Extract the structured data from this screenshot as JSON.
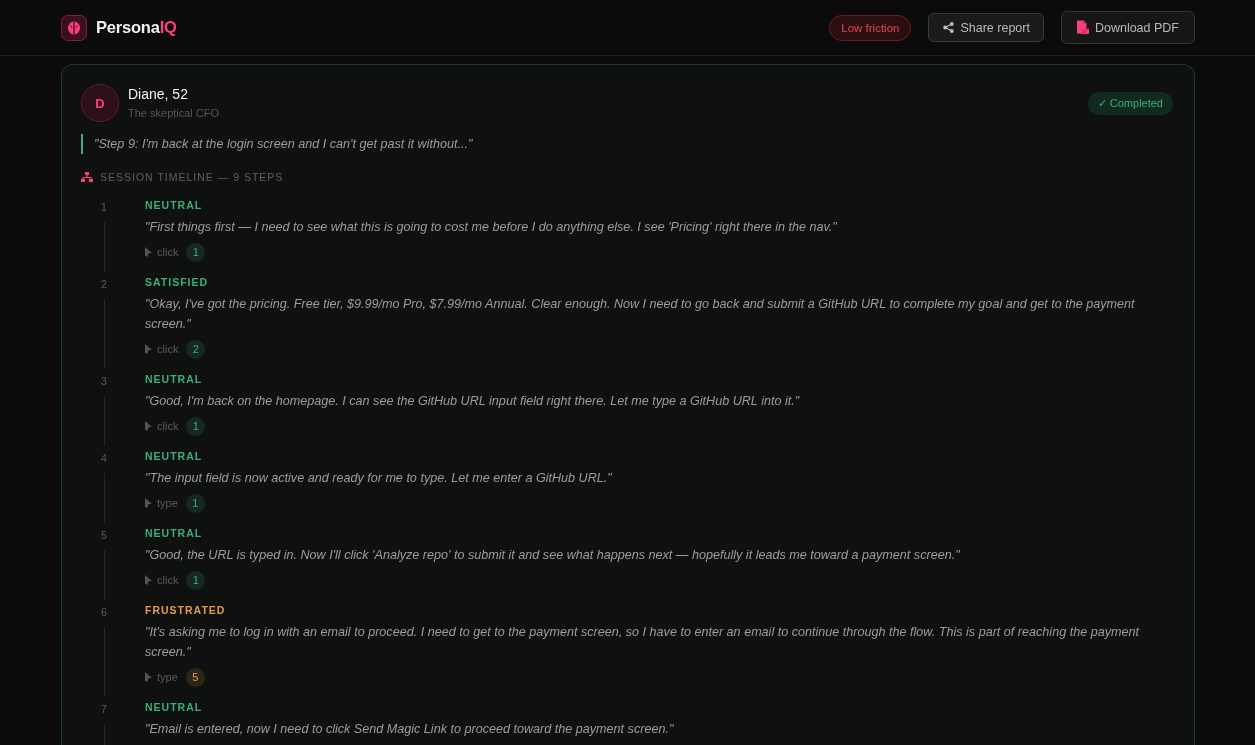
{
  "header": {
    "brand": "Persona",
    "brand_accent": "IQ",
    "friction_badge": "Low friction",
    "buttons": [
      {
        "kind": "share",
        "label": "Share report"
      },
      {
        "kind": "pdf",
        "label": "Download PDF"
      }
    ]
  },
  "persona": {
    "initial": "D",
    "name": "Diane, 52",
    "role": "The skeptical CFO",
    "status": "✓ Completed",
    "quote": "\"Step 9: I'm back at the login screen and I can't get past it without...\""
  },
  "timeline": {
    "title": "SESSION TIMELINE — 9 STEPS",
    "steps": [
      {
        "number": "1",
        "emotion": "NEUTRAL",
        "color": "#3bae7a",
        "quote": "\"First things first — I need to see what this is going to cost me before I do anything else. I see 'Pricing' right there in the nav.\"",
        "action": "click",
        "count": "1"
      },
      {
        "number": "2",
        "emotion": "SATISFIED",
        "color": "#3bae7a",
        "quote": "\"Okay, I've got the pricing. Free tier, $9.99/mo Pro, $7.99/mo Annual. Clear enough. Now I need to go back and submit a GitHub URL to complete my goal and get to the payment screen.\"",
        "action": "click",
        "count": "2"
      },
      {
        "number": "3",
        "emotion": "NEUTRAL",
        "color": "#3bae7a",
        "quote": "\"Good, I'm back on the homepage. I can see the GitHub URL input field right there. Let me type a GitHub URL into it.\"",
        "action": "click",
        "count": "1"
      },
      {
        "number": "4",
        "emotion": "NEUTRAL",
        "color": "#3bae7a",
        "quote": "\"The input field is now active and ready for me to type. Let me enter a GitHub URL.\"",
        "action": "type",
        "count": "1"
      },
      {
        "number": "5",
        "emotion": "NEUTRAL",
        "color": "#3bae7a",
        "quote": "\"Good, the URL is typed in. Now I'll click 'Analyze repo' to submit it and see what happens next — hopefully it leads me toward a payment screen.\"",
        "action": "click",
        "count": "1"
      },
      {
        "number": "6",
        "emotion": "FRUSTRATED",
        "color": "#e39b4c",
        "quote": "\"It's asking me to log in with an email to proceed. I need to get to the payment screen, so I have to enter an email to continue through the flow. This is part of reaching the payment screen.\"",
        "action": "type",
        "count": "5"
      },
      {
        "number": "7",
        "emotion": "NEUTRAL",
        "color": "#3bae7a",
        "quote": "\"Email is entered, now I need to click Send Magic Link to proceed toward the payment screen.\""
      }
    ]
  }
}
